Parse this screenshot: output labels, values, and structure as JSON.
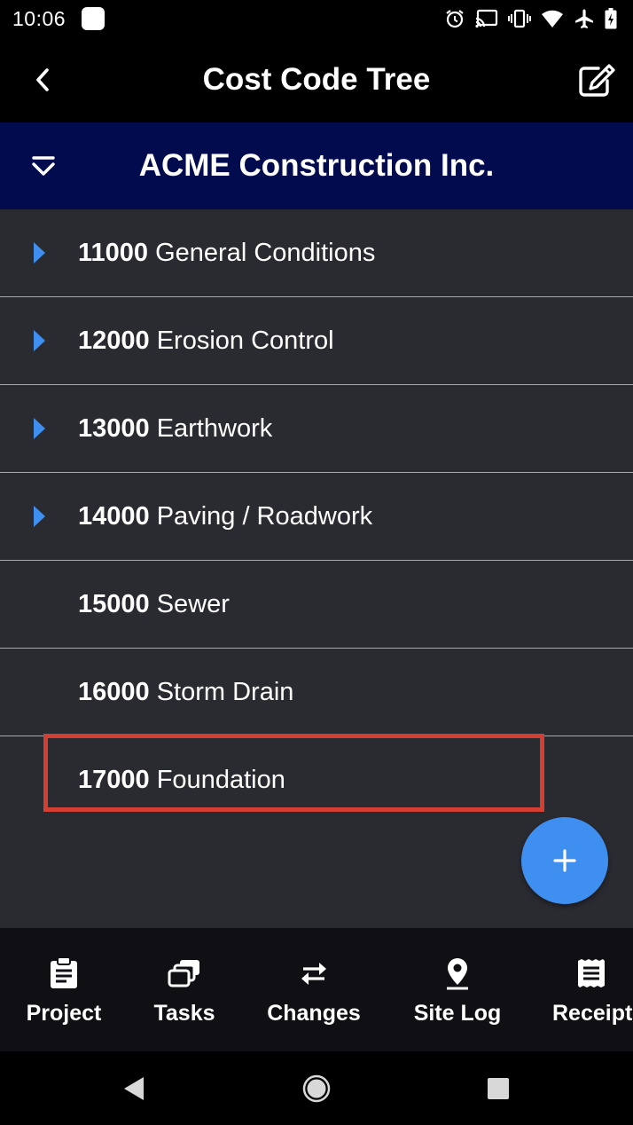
{
  "status_bar": {
    "time": "10:06",
    "icons": [
      "notification-square-icon",
      "alarm-icon",
      "cast-icon",
      "vibrate-icon",
      "wifi-icon",
      "airplane-icon",
      "battery-icon"
    ]
  },
  "app_bar": {
    "title": "Cost Code Tree",
    "back_icon": "chevron-left-icon",
    "edit_icon": "edit-icon"
  },
  "company": {
    "name": "ACME Construction Inc.",
    "collapse_icon": "collapse-chevron-icon"
  },
  "cost_codes": [
    {
      "code": "11000",
      "name": "General Conditions",
      "expandable": true
    },
    {
      "code": "12000",
      "name": "Erosion Control",
      "expandable": true
    },
    {
      "code": "13000",
      "name": "Earthwork",
      "expandable": true
    },
    {
      "code": "14000",
      "name": "Paving / Roadwork",
      "expandable": true
    },
    {
      "code": "15000",
      "name": "Sewer",
      "expandable": false
    },
    {
      "code": "16000",
      "name": "Storm Drain",
      "expandable": false
    },
    {
      "code": "17000",
      "name": "Foundation",
      "expandable": false,
      "highlighted": true
    }
  ],
  "fab": {
    "icon": "plus-icon"
  },
  "bottom_nav": [
    {
      "label": "Project",
      "icon": "clipboard-icon"
    },
    {
      "label": "Tasks",
      "icon": "tasks-icon"
    },
    {
      "label": "Changes",
      "icon": "swap-arrows-icon"
    },
    {
      "label": "Site Log",
      "icon": "location-pin-icon"
    },
    {
      "label": "Receipt",
      "icon": "receipt-icon"
    }
  ],
  "colors": {
    "app_bar": "#000000",
    "company_bar": "#020b4e",
    "list_bg": "#2a2a31",
    "accent_blue": "#3f8ff0",
    "highlight_red": "#d33f33"
  }
}
